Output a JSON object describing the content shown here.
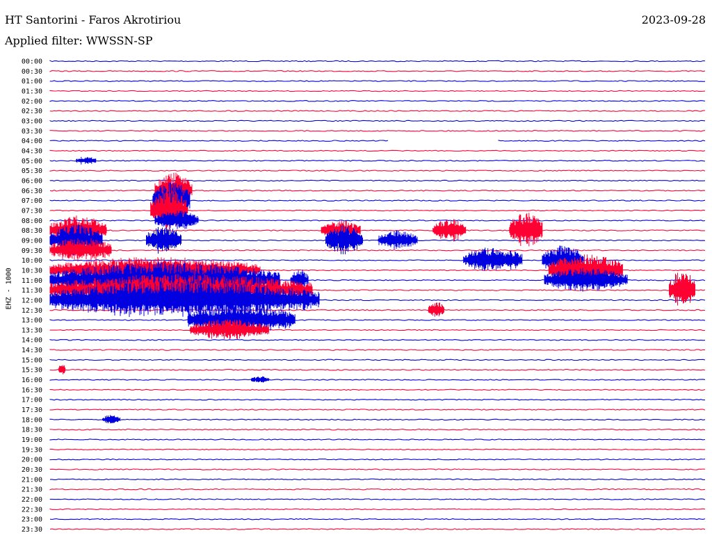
{
  "header": {
    "station": "HT Santorini - Faros Akrotiriou",
    "date": "2023-09-28",
    "filter": "Applied filter: WWSSN-SP",
    "channel": "EHZ - 1000"
  },
  "colors": {
    "odd_rows": "#0000e0",
    "even_rows": "#ff0033",
    "background": "#ffffff"
  },
  "chart_data": {
    "type": "line",
    "title": "HT Santorini - Faros Akrotiriou",
    "ylabel": "EHZ - 1000",
    "grid": false,
    "row_labels": [
      "00:00",
      "00:30",
      "01:00",
      "01:30",
      "02:00",
      "02:30",
      "03:00",
      "03:30",
      "04:00",
      "04:30",
      "05:00",
      "05:30",
      "06:00",
      "06:30",
      "07:00",
      "07:30",
      "08:00",
      "08:30",
      "09:00",
      "09:30",
      "10:00",
      "10:30",
      "11:00",
      "11:30",
      "12:00",
      "12:30",
      "13:00",
      "13:30",
      "14:00",
      "14:30",
      "15:00",
      "15:30",
      "16:00",
      "16:30",
      "17:00",
      "17:30",
      "18:00",
      "18:30",
      "19:00",
      "19:30",
      "20:00",
      "20:30",
      "21:00",
      "21:30",
      "22:00",
      "22:30",
      "23:00",
      "23:30"
    ],
    "row_colors": [
      "blue",
      "red"
    ],
    "trace_minutes": 30,
    "gaps": [
      {
        "row": "04:00",
        "from_min": 15.5,
        "to_min": 20.5
      }
    ],
    "events": [
      {
        "row": "05:00",
        "start_min": 1.2,
        "end_min": 2.1,
        "amp": 0.55
      },
      {
        "row": "06:30",
        "start_min": 4.8,
        "end_min": 6.5,
        "amp": 2.2
      },
      {
        "row": "07:00",
        "start_min": 4.7,
        "end_min": 6.4,
        "amp": 2.3
      },
      {
        "row": "07:30",
        "start_min": 4.6,
        "end_min": 6.3,
        "amp": 2.5
      },
      {
        "row": "08:00",
        "start_min": 4.8,
        "end_min": 6.8,
        "amp": 1.2
      },
      {
        "row": "08:30",
        "start_min": 0.0,
        "end_min": 2.6,
        "amp": 1.8
      },
      {
        "row": "08:30",
        "start_min": 12.4,
        "end_min": 14.2,
        "amp": 1.2
      },
      {
        "row": "08:30",
        "start_min": 17.5,
        "end_min": 19.0,
        "amp": 1.5
      },
      {
        "row": "08:30",
        "start_min": 21.0,
        "end_min": 22.5,
        "amp": 2.2
      },
      {
        "row": "09:00",
        "start_min": 0.0,
        "end_min": 2.4,
        "amp": 2.0
      },
      {
        "row": "09:00",
        "start_min": 4.4,
        "end_min": 6.0,
        "amp": 1.8
      },
      {
        "row": "09:00",
        "start_min": 12.6,
        "end_min": 14.3,
        "amp": 1.8
      },
      {
        "row": "09:00",
        "start_min": 15.0,
        "end_min": 16.8,
        "amp": 1.2
      },
      {
        "row": "09:30",
        "start_min": 0.0,
        "end_min": 2.8,
        "amp": 1.6
      },
      {
        "row": "10:00",
        "start_min": 18.9,
        "end_min": 21.6,
        "amp": 1.6
      },
      {
        "row": "10:00",
        "start_min": 22.5,
        "end_min": 24.4,
        "amp": 1.8
      },
      {
        "row": "10:30",
        "start_min": 0.0,
        "end_min": 9.6,
        "amp": 1.6
      },
      {
        "row": "10:30",
        "start_min": 22.8,
        "end_min": 26.2,
        "amp": 2.0
      },
      {
        "row": "11:00",
        "start_min": 0.0,
        "end_min": 10.5,
        "amp": 2.2
      },
      {
        "row": "11:00",
        "start_min": 11.0,
        "end_min": 11.8,
        "amp": 1.4
      },
      {
        "row": "11:00",
        "start_min": 22.6,
        "end_min": 26.4,
        "amp": 1.5
      },
      {
        "row": "11:30",
        "start_min": 0.0,
        "end_min": 12.0,
        "amp": 2.0
      },
      {
        "row": "11:30",
        "start_min": 28.3,
        "end_min": 29.5,
        "amp": 2.4
      },
      {
        "row": "12:00",
        "start_min": 0.0,
        "end_min": 12.3,
        "amp": 2.4
      },
      {
        "row": "12:30",
        "start_min": 17.3,
        "end_min": 18.0,
        "amp": 1.2
      },
      {
        "row": "13:00",
        "start_min": 6.3,
        "end_min": 11.2,
        "amp": 1.8
      },
      {
        "row": "13:30",
        "start_min": 6.4,
        "end_min": 10.0,
        "amp": 1.3
      },
      {
        "row": "15:30",
        "start_min": 0.4,
        "end_min": 0.7,
        "amp": 0.8
      },
      {
        "row": "16:00",
        "start_min": 9.2,
        "end_min": 10.0,
        "amp": 0.5
      },
      {
        "row": "18:00",
        "start_min": 2.4,
        "end_min": 3.2,
        "amp": 0.6
      }
    ]
  }
}
